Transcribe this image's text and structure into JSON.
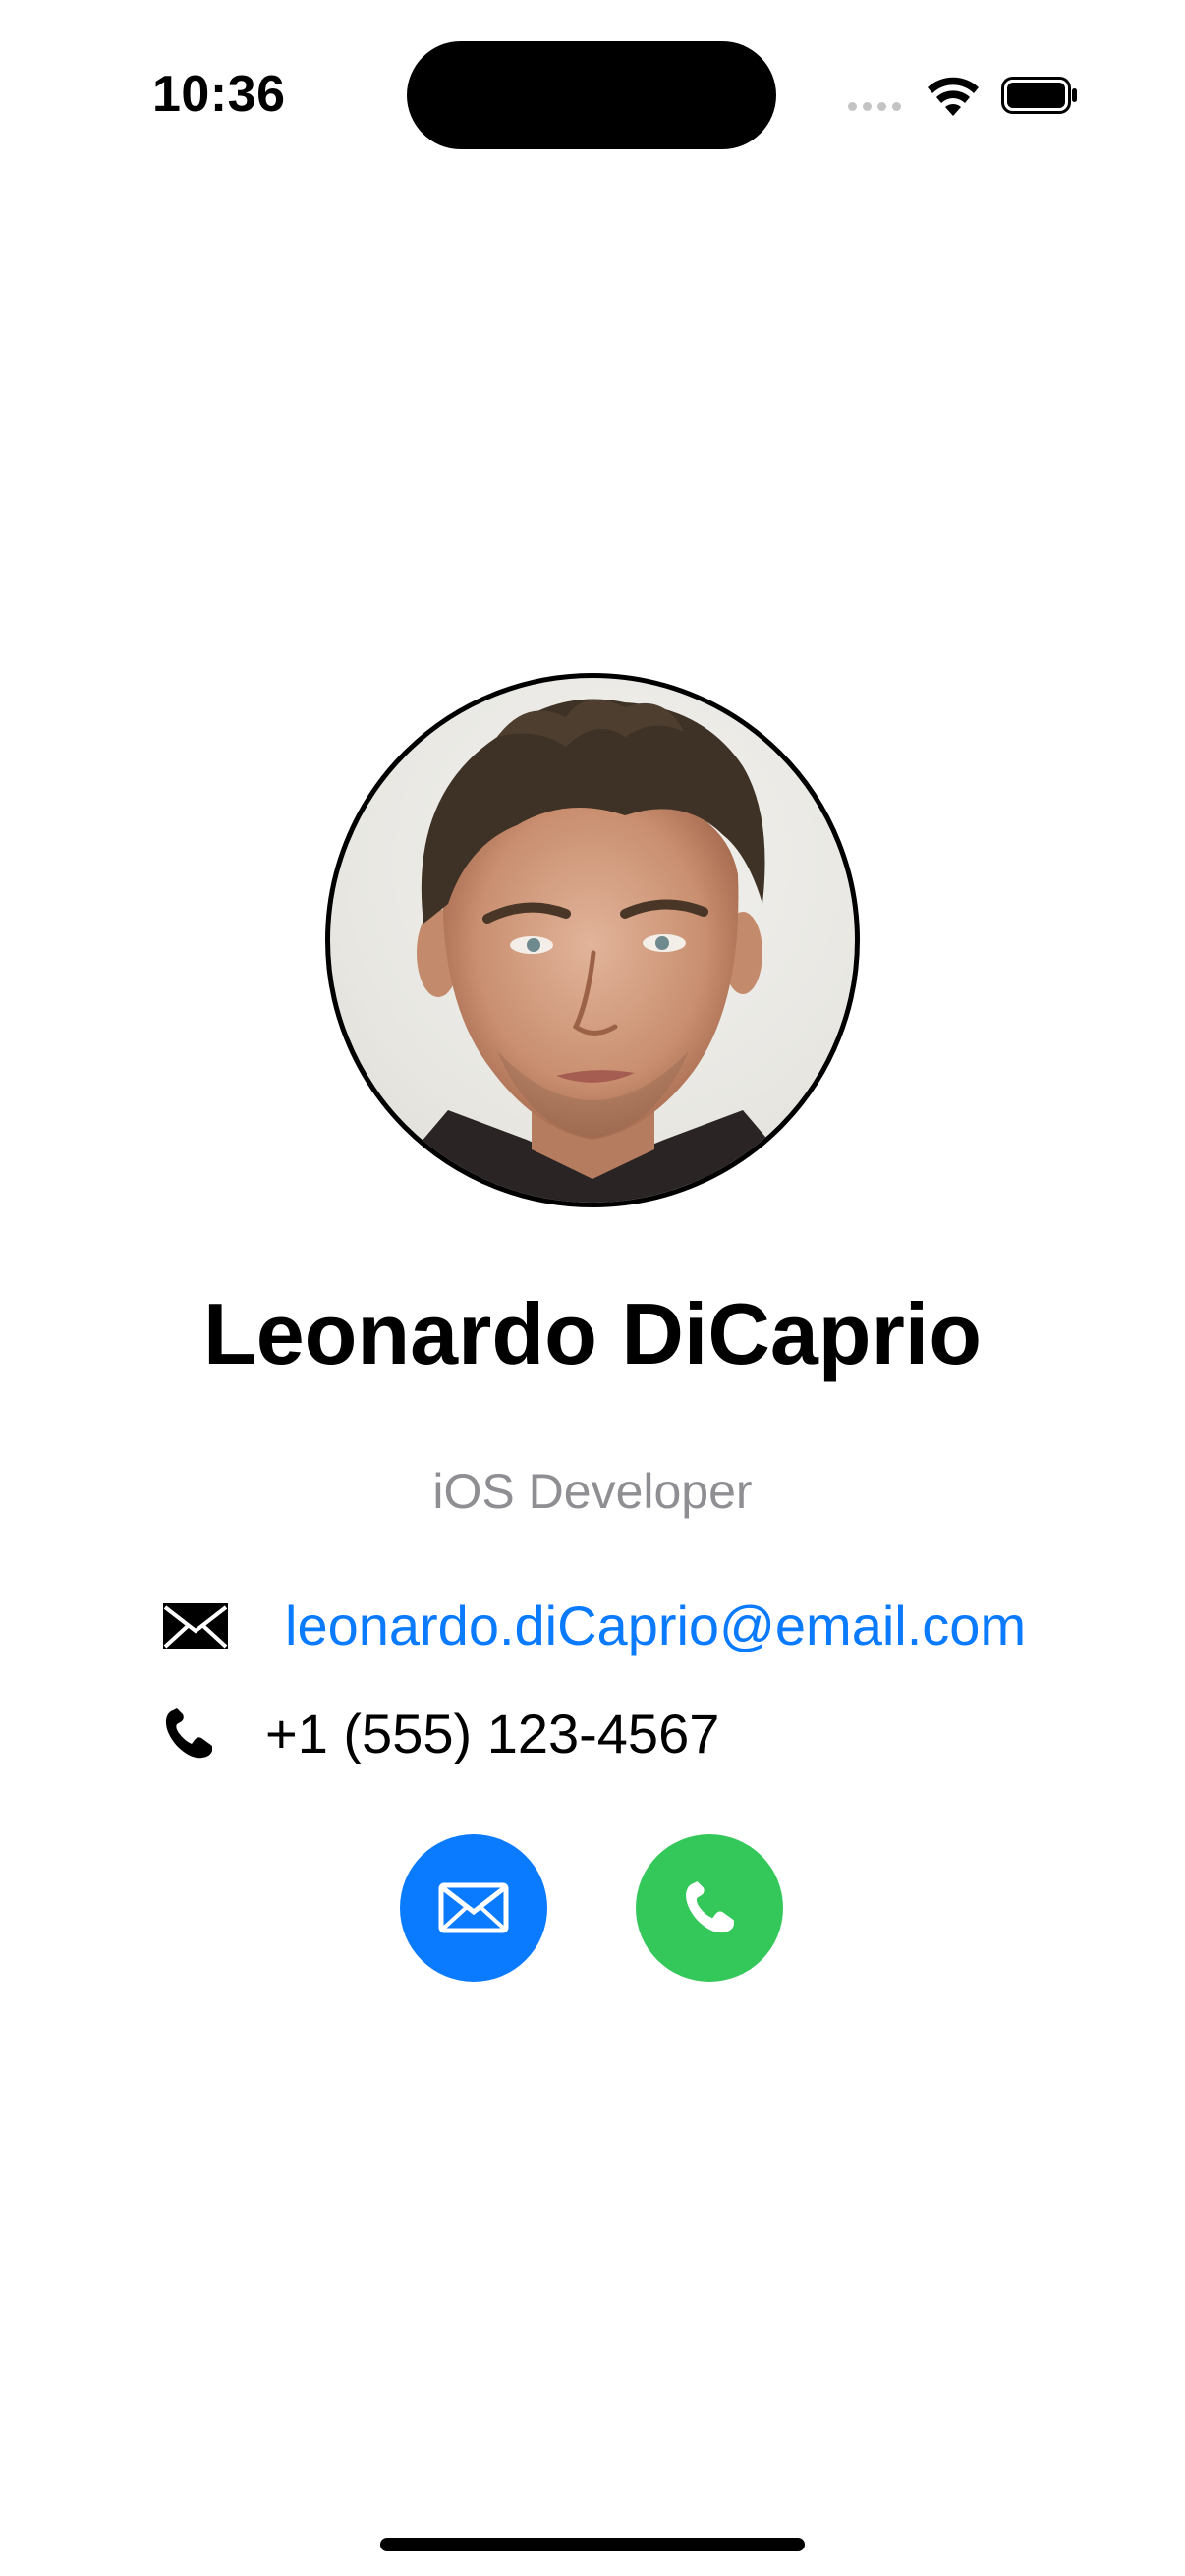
{
  "status_bar": {
    "time": "10:36",
    "signal_icon": "cellular-signal-icon",
    "wifi_icon": "wifi-icon",
    "battery_icon": "battery-icon"
  },
  "profile": {
    "avatar_icon": "profile-photo",
    "name": "Leonardo DiCaprio",
    "role": "iOS Developer"
  },
  "contact": {
    "email_icon": "envelope-icon",
    "email": "leonardo.diCaprio@email.com",
    "phone_icon": "phone-icon",
    "phone": "+1 (555) 123-4567"
  },
  "actions": {
    "mail_button_icon": "envelope-icon",
    "mail_button_color": "#0a7aff",
    "call_button_icon": "phone-icon",
    "call_button_color": "#34c759"
  },
  "colors": {
    "accent": "#0a7aff",
    "secondary_text": "#8e8e93",
    "call_green": "#34c759"
  }
}
